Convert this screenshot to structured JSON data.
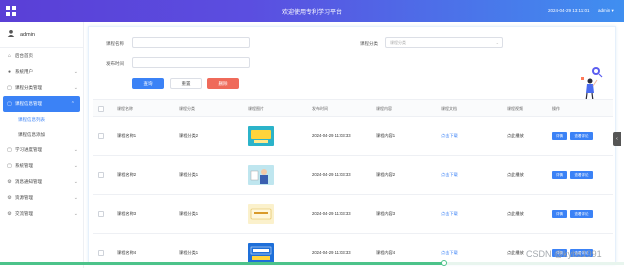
{
  "header": {
    "title": "欢迎使用专利学习平台",
    "datetime": "2024-04-29 13:11:01",
    "user_menu": "admin ▾"
  },
  "sidebar": {
    "username": "admin",
    "items": [
      {
        "label": "后台首页",
        "icon": "home-icon"
      },
      {
        "label": "系统用户",
        "icon": "person-icon",
        "expandable": true
      },
      {
        "label": "课程分类管理",
        "icon": "box-icon",
        "expandable": true
      },
      {
        "label": "课程信息管理",
        "icon": "box-icon",
        "expandable": true,
        "active": true
      },
      {
        "label": "学习进度管理",
        "icon": "box-icon",
        "expandable": true
      },
      {
        "label": "系统管理",
        "icon": "box-icon",
        "expandable": true
      },
      {
        "label": "消息通知管理",
        "icon": "gear-icon",
        "expandable": true
      },
      {
        "label": "资源管理",
        "icon": "gear-icon",
        "expandable": true
      },
      {
        "label": "交流管理",
        "icon": "gear-icon",
        "expandable": true
      }
    ],
    "subitems": [
      {
        "label": "课程信息列表",
        "active": true
      },
      {
        "label": "课程信息添加",
        "active": false
      }
    ]
  },
  "search": {
    "course_name_label": "课程名称",
    "course_name_value": "",
    "course_category_label": "课程分类",
    "course_category_placeholder": "课程分类",
    "publish_time_label": "发布时间",
    "publish_time_value": "",
    "search_button": "查询",
    "reset_button": "重置",
    "delete_button": "删除"
  },
  "table": {
    "columns": [
      "课程名称",
      "课程分类",
      "课程图片",
      "发布时间",
      "课程内容",
      "课程文档",
      "课程视频",
      "操作"
    ],
    "rows": [
      {
        "name": "课程名称1",
        "category": "课程分类2",
        "time": "2024-04-29 11:03:33",
        "content": "课程内容1",
        "doc": "点击下载",
        "video": "点此播放",
        "image": "promo-banner"
      },
      {
        "name": "课程名称2",
        "category": "课程分类1",
        "time": "2024-04-29 11:03:33",
        "content": "课程内容2",
        "doc": "点击下载",
        "video": "点此播放",
        "image": "person-doc"
      },
      {
        "name": "课程名称3",
        "category": "课程分类1",
        "time": "2024-04-29 11:03:33",
        "content": "课程内容3",
        "doc": "点击下载",
        "video": "点此播放",
        "image": "patent-apply-card"
      },
      {
        "name": "课程名称4",
        "category": "课程分类1",
        "time": "2024-04-29 11:03:33",
        "content": "课程内容4",
        "doc": "点击下载",
        "video": "点此播放",
        "image": "patent-apply-blue"
      }
    ],
    "row_actions": [
      "详情",
      "查看评论"
    ]
  },
  "watermark": "CSDN @kybs1991",
  "colors": {
    "header_gradient_start": "#5a3fd6",
    "header_gradient_end": "#3f8ff0",
    "primary": "#3b82f6",
    "danger": "#ef6a5a",
    "progress": "#4cc38a"
  }
}
